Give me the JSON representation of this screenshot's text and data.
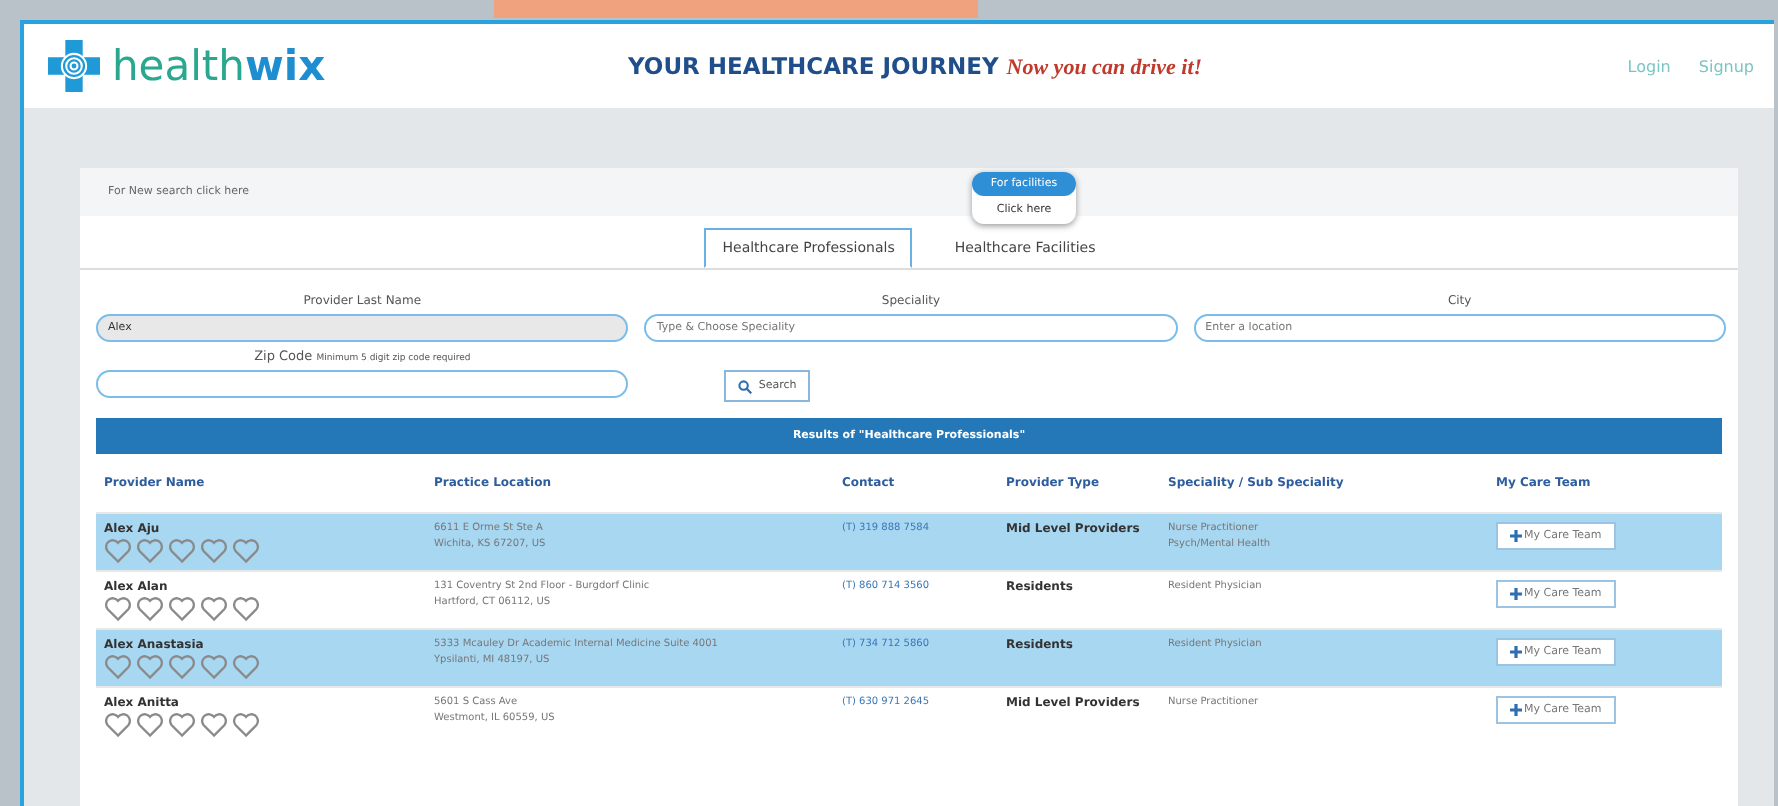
{
  "header": {
    "logo": "health",
    "logo_bold": "wix",
    "tagline": "YOUR HEALTHCARE JOURNEY",
    "tagline_script": "Now you can drive it!",
    "links": [
      "Login",
      "Signup"
    ]
  },
  "search_bar": {
    "new_search": "For New search click here",
    "facilities_badge": "For facilities",
    "facilities_link": "Click here"
  },
  "tabs": [
    {
      "label": "Healthcare Professionals",
      "selected": true
    },
    {
      "label": "Healthcare Facilities",
      "selected": false
    }
  ],
  "form": {
    "fields": [
      {
        "label": "Provider Last Name",
        "value": "Alex"
      },
      {
        "label": "Speciality",
        "placeholder": "Type & Choose Speciality"
      },
      {
        "label": "City",
        "placeholder": "Enter a location"
      }
    ],
    "zip": {
      "label": "Zip Code",
      "hint": "Minimum 5 digit zip code required"
    },
    "search_button": "Search"
  },
  "results": {
    "title": "Results of \"Healthcare Professionals\"",
    "columns": [
      "Provider Name",
      "Practice Location",
      "Contact",
      "Provider Type",
      "Speciality / Sub Speciality",
      "My Care Team"
    ],
    "rows": [
      {
        "name": "Alex Aju",
        "stars": 0,
        "location": [
          "6611 E Orme St Ste A",
          "Wichita, KS 67207, US"
        ],
        "contact": "(T) 319 888 7584",
        "type": "Mid Level Providers",
        "speciality": [
          "Nurse Practitioner",
          "Psych/Mental Health"
        ],
        "action": "My Care Team"
      },
      {
        "name": "Alex Alan",
        "stars": 0,
        "location": [
          "131 Coventry St 2nd Floor - Burgdorf Clinic",
          "Hartford, CT 06112, US"
        ],
        "contact": "(T) 860 714 3560",
        "type": "Residents",
        "speciality": [
          "Resident Physician"
        ],
        "action": "My Care Team"
      },
      {
        "name": "Alex Anastasia",
        "stars": 0,
        "location": [
          "5333 Mcauley Dr Academic Internal Medicine Suite 4001",
          "Ypsilanti, MI 48197, US"
        ],
        "contact": "(T) 734 712 5860",
        "type": "Residents",
        "speciality": [
          "Resident Physician"
        ],
        "action": "My Care Team"
      },
      {
        "name": "Alex Anitta",
        "stars": 0,
        "location": [
          "5601 S Cass Ave",
          "Westmont, IL 60559, US"
        ],
        "contact": "(T) 630 971 2645",
        "type": "Mid Level Providers",
        "speciality": [
          "Nurse Practitioner"
        ],
        "action": "My Care Team"
      }
    ]
  }
}
